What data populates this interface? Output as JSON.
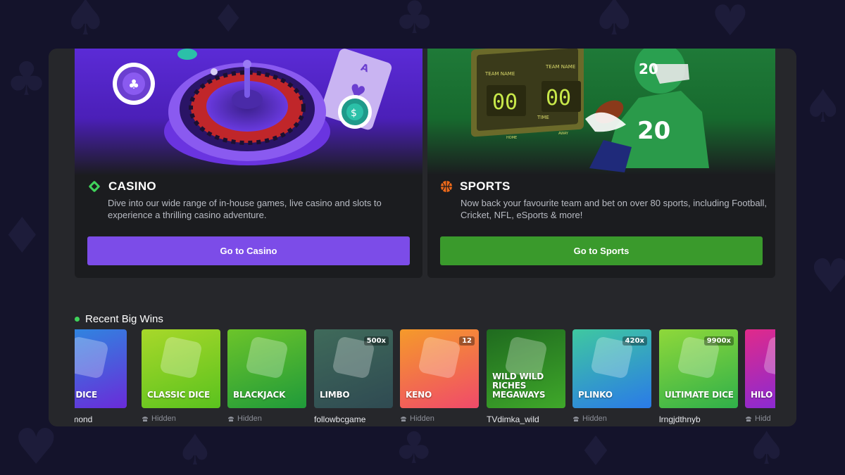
{
  "casino": {
    "title": "CASINO",
    "description": "Dive into our wide range of in-house games, live casino and slots to experience a thrilling casino adventure.",
    "button_label": "Go to Casino",
    "scoreboard": null
  },
  "sports": {
    "title": "SPORTS",
    "description": "Now back your favourite team and bet on over 80 sports, including Football, Cricket, NFL, eSports & more!",
    "button_label": "Go to Sports",
    "scoreboard": {
      "team_label_1": "TEAM NAME",
      "team_label_2": "TEAM NAME",
      "score_1": "00",
      "score_2": "00",
      "time_label": "TIME",
      "home_label": "HOME",
      "away_label": "AWAY",
      "jersey_number": "20"
    }
  },
  "recent_wins": {
    "heading": "Recent Big Wins",
    "games": [
      {
        "name": "ASH DICE",
        "user": "ck Daimond",
        "hidden": false,
        "color_a": "#6a2bd9",
        "color_b": "#2a8de0"
      },
      {
        "name": "CLASSIC DICE",
        "user": "Hidden",
        "hidden": true,
        "color_a": "#5ac21e",
        "color_b": "#a8d82a"
      },
      {
        "name": "BLACKJACK",
        "user": "Hidden",
        "hidden": true,
        "color_a": "#1f9a3a",
        "color_b": "#6cc42a"
      },
      {
        "name": "LIMBO",
        "user": "followbcgame",
        "hidden": false,
        "color_a": "#2f4a52",
        "color_b": "#3f6a5a",
        "badge": "500x"
      },
      {
        "name": "KENO",
        "user": "Hidden",
        "hidden": true,
        "color_a": "#f04a6a",
        "color_b": "#f59a2a",
        "badge": "12"
      },
      {
        "name": "WILD WILD RICHES MEGAWAYS",
        "user": "TVdimka_wild",
        "hidden": false,
        "color_a": "#3fa82a",
        "color_b": "#1f6a1f"
      },
      {
        "name": "PLINKO",
        "user": "Hidden",
        "hidden": true,
        "color_a": "#2a7ae8",
        "color_b": "#3fc8a0",
        "badge": "420x"
      },
      {
        "name": "ULTIMATE DICE",
        "user": "lrngjdthnyb",
        "hidden": false,
        "color_a": "#2fb04a",
        "color_b": "#8fd83a",
        "badge": "9900x"
      },
      {
        "name": "HILO",
        "user": "Hidd",
        "hidden": true,
        "color_a": "#7a2ae0",
        "color_b": "#e02a8a"
      }
    ]
  },
  "colors": {
    "casino_accent": "#7c4ce8",
    "sports_accent": "#3a9a2c",
    "live_dot": "#3fd25a"
  }
}
